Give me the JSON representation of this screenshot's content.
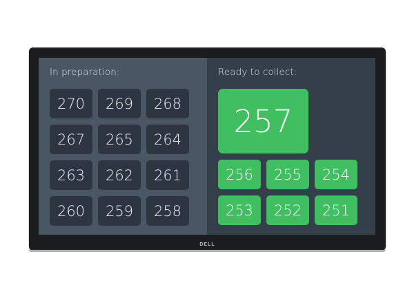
{
  "preparation": {
    "title": "In preparation:",
    "orders": [
      "270",
      "269",
      "268",
      "267",
      "265",
      "264",
      "263",
      "262",
      "261",
      "260",
      "259",
      "258"
    ]
  },
  "ready": {
    "title": "Ready to collect:",
    "featured": "257",
    "orders": [
      "256",
      "255",
      "254",
      "253",
      "252",
      "251"
    ]
  },
  "brand": "DELL",
  "colors": {
    "prep_panel": "#4a5663",
    "prep_tile": "#2c3540",
    "ready_panel": "#343f4a",
    "ready_tile": "#3fbf60",
    "bezel": "#1b1c1e"
  }
}
